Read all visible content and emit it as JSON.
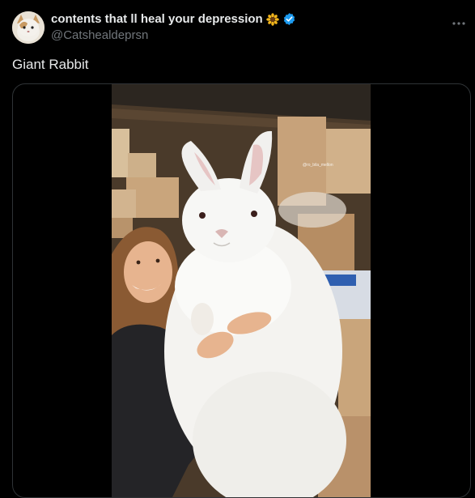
{
  "post": {
    "display_name": "contents that ll heal your depression",
    "handle": "@Catshealdeprsn",
    "text": "Giant Rabbit",
    "more_icon": "more-horizontal-icon",
    "verified_icon": "verified-badge-icon",
    "emoji_icon": "sunflower-icon"
  },
  "media": {
    "watermark": "@ro_bila_mellon"
  },
  "colors": {
    "background": "#000000",
    "text": "#e7e9ea",
    "secondary": "#71767b",
    "verified": "#1d9bf0",
    "border": "#2f3336"
  }
}
